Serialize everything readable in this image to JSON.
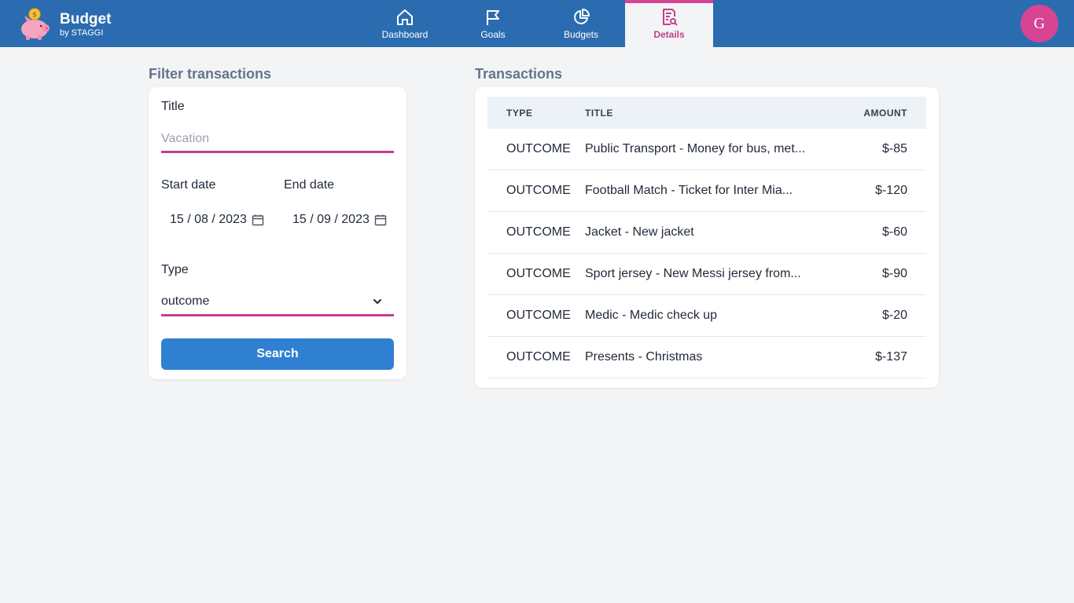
{
  "brand": {
    "name": "Budget",
    "sub": "by STAGGI",
    "logo_icon": "piggy-bank-icon"
  },
  "nav": [
    {
      "label": "Dashboard",
      "icon": "home-icon",
      "active": false
    },
    {
      "label": "Goals",
      "icon": "flag-icon",
      "active": false
    },
    {
      "label": "Budgets",
      "icon": "pie-chart-icon",
      "active": false
    },
    {
      "label": "Details",
      "icon": "document-search-icon",
      "active": true
    }
  ],
  "user": {
    "initial": "G"
  },
  "filter": {
    "heading": "Filter transactions",
    "title_label": "Title",
    "title_placeholder": "Vacation",
    "title_value": "",
    "start_label": "Start date",
    "start_value": "15 / 08 / 2023",
    "end_label": "End date",
    "end_value": "15 / 09 / 2023",
    "type_label": "Type",
    "type_value": "outcome",
    "search_label": "Search"
  },
  "transactions": {
    "heading": "Transactions",
    "columns": [
      "TYPE",
      "TITLE",
      "AMOUNT"
    ],
    "rows": [
      {
        "type": "OUTCOME",
        "title": "Public Transport - Money for bus, met...",
        "amount": "$-85"
      },
      {
        "type": "OUTCOME",
        "title": "Football Match - Ticket for Inter Mia...",
        "amount": "$-120"
      },
      {
        "type": "OUTCOME",
        "title": "Jacket - New jacket",
        "amount": "$-60"
      },
      {
        "type": "OUTCOME",
        "title": "Sport jersey - New Messi jersey from...",
        "amount": "$-90"
      },
      {
        "type": "OUTCOME",
        "title": "Medic - Medic check up",
        "amount": "$-20"
      },
      {
        "type": "OUTCOME",
        "title": "Presents - Christmas",
        "amount": "$-137"
      }
    ]
  },
  "colors": {
    "header": "#2b6cb0",
    "accent": "#d64492",
    "button": "#2f80d1",
    "background": "#f3f4f6"
  }
}
